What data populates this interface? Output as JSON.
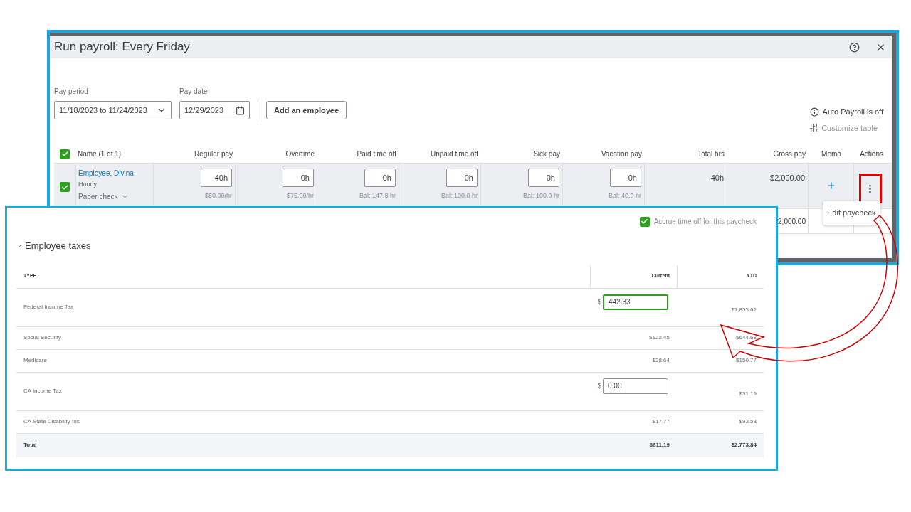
{
  "payroll_window": {
    "title": "Run payroll: Every Friday",
    "pay_period": {
      "label": "Pay period",
      "value": "11/18/2023 to 11/24/2023"
    },
    "pay_date": {
      "label": "Pay date",
      "value": "12/29/2023"
    },
    "add_button": "Add an employee",
    "auto_payroll": "Auto Payroll is off",
    "customize": "Customize table",
    "select_all_checked": true,
    "columns": [
      "Name (1 of 1)",
      "Regular pay",
      "Overtime",
      "Paid time off",
      "Unpaid time off",
      "Sick pay",
      "Vacation pay",
      "Total hrs",
      "Gross pay",
      "Memo",
      "Actions"
    ],
    "rows": [
      {
        "checked": true,
        "cells": [
          {
            "kind": "employee",
            "name": "Employee, Divina",
            "pay_type": "Hourly",
            "payment_method": "Paper check"
          },
          {
            "kind": "hours",
            "hours": "40h",
            "note": "$50.00/hr"
          },
          {
            "kind": "hours",
            "hours": "0h",
            "note": "$75.00/hr"
          },
          {
            "kind": "hours",
            "hours": "0h",
            "note": "Bal: 147.8 hr"
          },
          {
            "kind": "hours",
            "hours": "0h",
            "note": "Bal: 100.0 hr"
          },
          {
            "kind": "hours",
            "hours": "0h",
            "note": "Bal: 100.0 hr"
          },
          {
            "kind": "hours",
            "hours": "0h",
            "note": "Bal: 40.0 hr"
          },
          {
            "kind": "amount",
            "text": "40h"
          },
          {
            "kind": "amount",
            "text": "$2,000.00"
          },
          {
            "kind": "memo"
          },
          {
            "kind": "actions"
          }
        ]
      }
    ],
    "total_row": {
      "gross_pay": "2,000.00"
    },
    "menu": {
      "items": [
        "Edit paycheck"
      ]
    }
  },
  "tax_panel": {
    "accrue": {
      "label": "Accrue time off for this paycheck",
      "checked": true
    },
    "section": {
      "title": "Employee taxes",
      "expanded": true
    },
    "columns": [
      "TYPE",
      "Current",
      "YTD"
    ],
    "rows": [
      {
        "kind": "input",
        "type": "Federal Income Tax",
        "currency": "$",
        "current": "442.33",
        "focused": true,
        "ytd": "$1,853.62"
      },
      {
        "kind": "text",
        "type": "Social Security",
        "current": "$122.45",
        "ytd": "$644.68"
      },
      {
        "kind": "text",
        "type": "Medicare",
        "current": "$28.64",
        "ytd": "$150.77"
      },
      {
        "kind": "input",
        "type": "CA Income Tax",
        "currency": "$",
        "current": "0.00",
        "focused": false,
        "ytd": "$31.19"
      },
      {
        "kind": "text",
        "type": "CA State Disability Ins",
        "current": "$17.77",
        "ytd": "$93.58"
      }
    ],
    "total": {
      "label": "Total",
      "current": "$611.19",
      "ytd": "$2,773.84"
    }
  }
}
